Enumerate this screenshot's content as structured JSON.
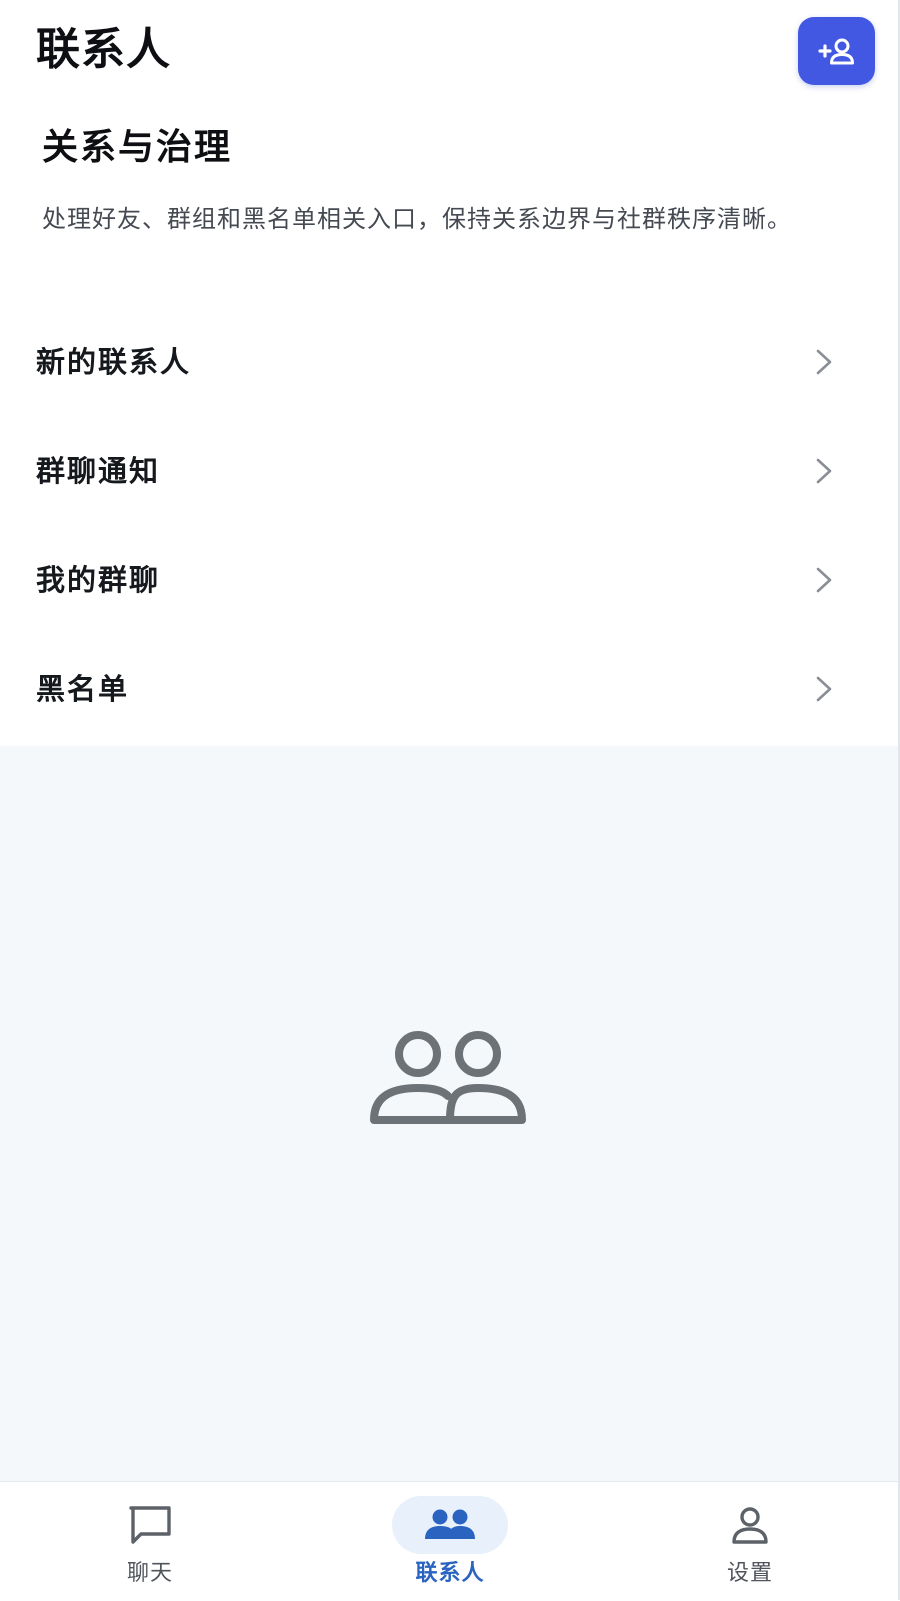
{
  "header": {
    "title": "联系人",
    "add_contact_icon": "person-add-icon"
  },
  "intro": {
    "title": "关系与治理",
    "description": "处理好友、群组和黑名单相关入口，保持关系边界与社群秩序清晰。"
  },
  "menu": {
    "items": [
      {
        "label": "新的联系人",
        "icon": "chevron-right-icon"
      },
      {
        "label": "群聊通知",
        "icon": "chevron-right-icon"
      },
      {
        "label": "我的群聊",
        "icon": "chevron-right-icon"
      },
      {
        "label": "黑名单",
        "icon": "chevron-right-icon"
      }
    ]
  },
  "empty_state": {
    "icon": "people-outline-icon"
  },
  "nav": {
    "items": [
      {
        "label": "聊天",
        "icon": "chat-bubble-icon",
        "active": false
      },
      {
        "label": "联系人",
        "icon": "people-icon",
        "active": true
      },
      {
        "label": "设置",
        "icon": "person-icon",
        "active": false
      }
    ]
  },
  "colors": {
    "accent": "#4258e3",
    "active_nav": "#2a64c0",
    "empty_bg": "#f4f8fb",
    "icon_gray": "#6d7276"
  }
}
